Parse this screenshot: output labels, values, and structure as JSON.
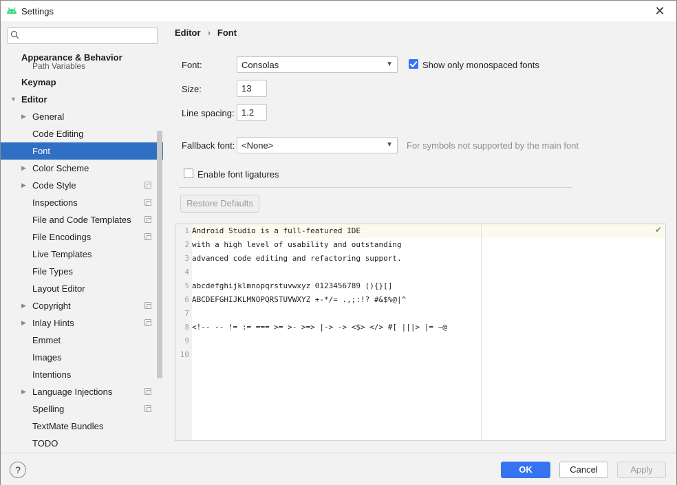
{
  "window": {
    "title": "Settings",
    "close_glyph": "✕"
  },
  "search": {
    "placeholder": "",
    "icon": "search-icon"
  },
  "sidebar": {
    "partial_item": "Path Variables",
    "items": [
      {
        "label": "Appearance & Behavior",
        "bold": true
      },
      {
        "label": "Keymap",
        "bold": true
      },
      {
        "label": "Editor",
        "bold": true
      },
      {
        "label": "General"
      },
      {
        "label": "Code Editing"
      },
      {
        "label": "Font",
        "selected": true
      },
      {
        "label": "Color Scheme"
      },
      {
        "label": "Code Style"
      },
      {
        "label": "Inspections"
      },
      {
        "label": "File and Code Templates"
      },
      {
        "label": "File Encodings"
      },
      {
        "label": "Live Templates"
      },
      {
        "label": "File Types"
      },
      {
        "label": "Layout Editor"
      },
      {
        "label": "Copyright"
      },
      {
        "label": "Inlay Hints"
      },
      {
        "label": "Emmet"
      },
      {
        "label": "Images"
      },
      {
        "label": "Intentions"
      },
      {
        "label": "Language Injections"
      },
      {
        "label": "Spelling"
      },
      {
        "label": "TextMate Bundles"
      },
      {
        "label": "TODO"
      }
    ]
  },
  "breadcrumb": {
    "parent": "Editor",
    "separator": "›",
    "current": "Font"
  },
  "font": {
    "font_label": "Font:",
    "font_value": "Consolas",
    "monospaced_label": "Show only monospaced fonts",
    "monospaced_checked": true,
    "size_label": "Size:",
    "size_value": "13",
    "line_spacing_label": "Line spacing:",
    "line_spacing_value": "1.2",
    "fallback_label": "Fallback font:",
    "fallback_value": "<None>",
    "fallback_hint": "For symbols not supported by the main font",
    "ligatures_label": "Enable font ligatures",
    "ligatures_checked": false,
    "restore_defaults": "Restore Defaults"
  },
  "preview": {
    "lines": [
      {
        "n": "1",
        "text": "Android Studio is a full-featured IDE"
      },
      {
        "n": "2",
        "text": "with a high level of usability and outstanding"
      },
      {
        "n": "3",
        "text": "advanced code editing and refactoring support."
      },
      {
        "n": "4",
        "text": ""
      },
      {
        "n": "5",
        "text": "abcdefghijklmnopqrstuvwxyz 0123456789 (){}[]"
      },
      {
        "n": "6",
        "text": "ABCDEFGHIJKLMNOPQRSTUVWXYZ +-*/= .,;:!? #&$%@|^"
      },
      {
        "n": "7",
        "text": ""
      },
      {
        "n": "8",
        "text": "<!-- -- != := === >= >- >=> |-> -> <$> </> #[ |||> |= ~@"
      },
      {
        "n": "9",
        "text": ""
      },
      {
        "n": "10",
        "text": ""
      }
    ],
    "status_glyph": "✔"
  },
  "footer": {
    "help": "?",
    "ok": "OK",
    "cancel": "Cancel",
    "apply": "Apply"
  },
  "colors": {
    "accent": "#3574f0",
    "selection": "#2f6fc4",
    "background": "#f2f2f2"
  }
}
